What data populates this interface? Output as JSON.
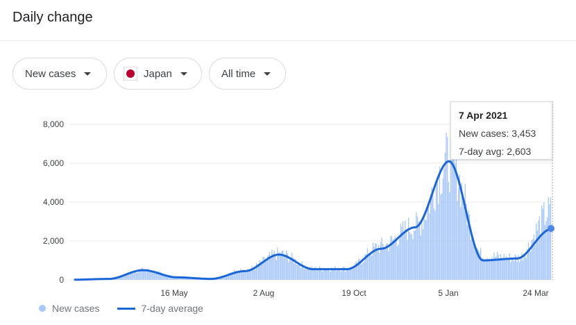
{
  "header": {
    "title": "Daily change"
  },
  "filters": {
    "metric": {
      "label": "New cases"
    },
    "location": {
      "label": "Japan",
      "flag_icon": "japan-flag-icon"
    },
    "range": {
      "label": "All time"
    }
  },
  "tooltip": {
    "date": "7 Apr 2021",
    "new_cases": "New cases: 3,453",
    "avg": "7-day avg: 2,603"
  },
  "colors": {
    "bars": "#a8c7fa",
    "line": "#1a66d9",
    "grid": "#ebebeb",
    "axis_text": "#3c4043"
  },
  "chart_data": {
    "type": "bar",
    "y_ticks": [
      "0",
      "2,000",
      "4,000",
      "6,000",
      "8,000"
    ],
    "x_ticks": [
      "16 May",
      "2 Aug",
      "19 Oct",
      "5 Jan",
      "24 Mar"
    ],
    "ylim": [
      0,
      8000
    ],
    "grid": true,
    "legend": "bottom-left",
    "series": [
      {
        "name": "New cases",
        "type": "bar",
        "x": [
          "Feb 2020",
          "Mar 2020",
          "Apr 2020",
          "May 2020",
          "Jun 2020",
          "Jul 2020",
          "Aug 2020",
          "Sep 2020",
          "Oct 2020",
          "Nov 2020",
          "Dec 2020",
          "Jan 2021",
          "Feb 2021",
          "Mar 2021",
          "Apr 2021"
        ],
        "values": [
          10,
          60,
          500,
          140,
          60,
          500,
          1300,
          560,
          560,
          1700,
          2700,
          6000,
          1200,
          1100,
          3453
        ]
      },
      {
        "name": "7-day average",
        "type": "line",
        "x": [
          "Feb 2020",
          "Mar 2020",
          "Apr 2020",
          "May 2020",
          "Jun 2020",
          "Jul 2020",
          "Aug 2020",
          "Sep 2020",
          "Oct 2020",
          "Nov 2020",
          "Dec 2020",
          "Jan 2021",
          "Feb 2021",
          "Mar 2021",
          "Apr 2021"
        ],
        "values": [
          10,
          50,
          500,
          130,
          50,
          450,
          1300,
          550,
          550,
          1600,
          2700,
          6100,
          1000,
          1100,
          2603
        ]
      }
    ]
  },
  "legend": {
    "bars_label": "New cases",
    "line_label": "7-day average"
  }
}
